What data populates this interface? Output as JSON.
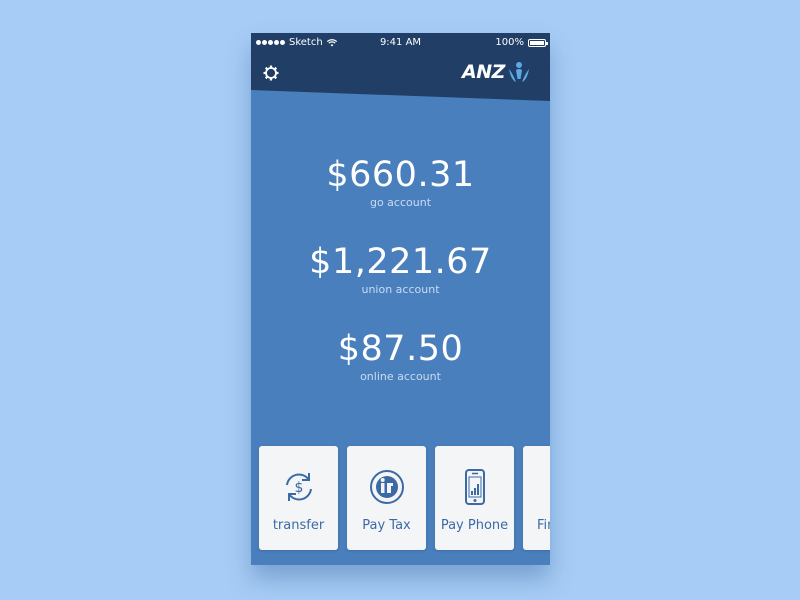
{
  "status_bar": {
    "carrier": "Sketch",
    "time": "9:41 AM",
    "battery": "100%"
  },
  "header": {
    "logo_text": "ANZ",
    "settings_icon": "gear-icon"
  },
  "accounts": [
    {
      "amount": "$660.31",
      "name": "go account"
    },
    {
      "amount": "$1,221.67",
      "name": "union account"
    },
    {
      "amount": "$87.50",
      "name": "online account"
    }
  ],
  "actions": [
    {
      "label": "transfer",
      "icon": "dollar-refresh-icon"
    },
    {
      "label": "Pay Tax",
      "icon": "tax-icon"
    },
    {
      "label": "Pay Phone",
      "icon": "phone-icon"
    },
    {
      "label": "Fin",
      "icon": "partial-card"
    }
  ],
  "colors": {
    "background": "#a7cdf6",
    "header": "#213f66",
    "body": "#4a7fbd",
    "card": "#f4f5f7",
    "accent": "#3b6aa5"
  }
}
